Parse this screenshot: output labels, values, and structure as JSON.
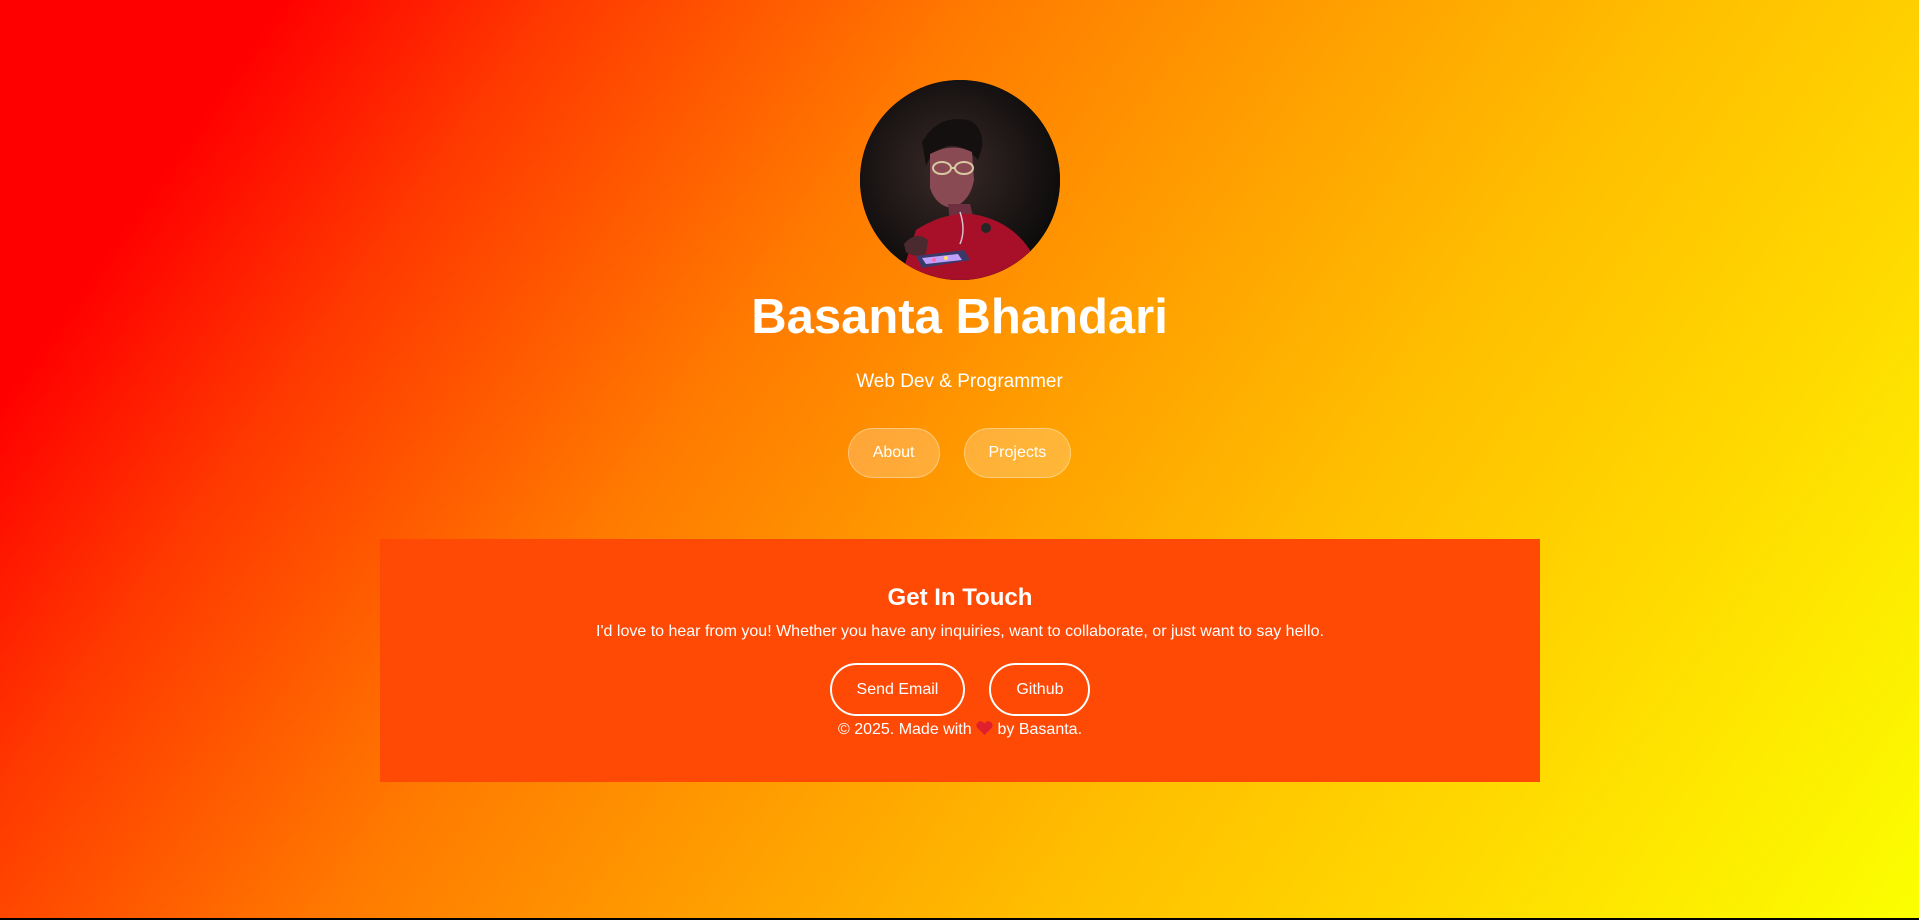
{
  "profile": {
    "name": "Basanta Bhandari",
    "tagline": "Web Dev & Programmer",
    "avatar_alt": "Profile photo"
  },
  "nav": {
    "about_label": "About",
    "projects_label": "Projects"
  },
  "contact": {
    "title": "Get In Touch",
    "text": "I'd love to hear from you! Whether you have any inquiries, want to collaborate, or just want to say hello.",
    "email_label": "Send Email",
    "github_label": "Github"
  },
  "footer": {
    "before_icon": "© 2025. Made with",
    "icon": "heart-icon",
    "after_icon": "by Basanta."
  },
  "colors": {
    "contact_bg": "#ff4a06",
    "text": "#ffffff",
    "gradient_start": "#ff0000",
    "gradient_end": "#fbff00",
    "heart": "#e0202c"
  }
}
